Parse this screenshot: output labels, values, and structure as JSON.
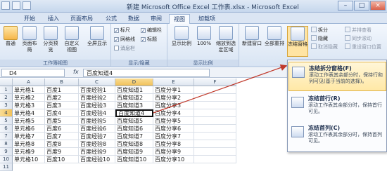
{
  "titlebar": {
    "title": "新建 Microsoft Office Excel 工作表.xlsx - Microsoft Excel",
    "minimize": "–",
    "maximize": "□",
    "close": "×"
  },
  "tabs": [
    "开始",
    "插入",
    "页面布局",
    "公式",
    "数据",
    "审阅",
    "视图",
    "加载项"
  ],
  "active_tab": "视图",
  "ribbon": {
    "workbook_views": {
      "label": "工作簿视图",
      "buttons": [
        "普通",
        "页面布局",
        "分页预览",
        "自定义视图",
        "全屏显示"
      ]
    },
    "show_hide": {
      "label": "显示/隐藏",
      "checks": [
        {
          "label": "标尺",
          "checked": true
        },
        {
          "label": "网格线",
          "checked": true
        },
        {
          "label": "消息栏",
          "checked": false
        },
        {
          "label": "编辑栏",
          "checked": true
        },
        {
          "label": "标题",
          "checked": true
        }
      ]
    },
    "zoom": {
      "label": "显示比例",
      "buttons": [
        "显示比例",
        "100%",
        "缩放到选定区域"
      ]
    },
    "window": {
      "buttons": [
        "新建窗口",
        "全部重排",
        "冻结窗格"
      ],
      "small": [
        "拆分",
        "隐藏",
        "取消隐藏",
        "并排查看",
        "同步滚动",
        "重设窗口位置"
      ]
    }
  },
  "formula_bar": {
    "name_box": "D4",
    "fx": "fx",
    "content": "百度知道4"
  },
  "columns": [
    "A",
    "B",
    "C",
    "D",
    "E",
    "F"
  ],
  "selected_column": "D",
  "selected_row": 4,
  "rows": [
    [
      "单元格1",
      "百度1",
      "百度经验1",
      "百度知道1",
      "百度分享1"
    ],
    [
      "单元格2",
      "百度2",
      "百度经验2",
      "百度知道2",
      "百度分享2"
    ],
    [
      "单元格3",
      "百度3",
      "百度经验3",
      "百度知道3",
      "百度分享3"
    ],
    [
      "单元格4",
      "百度4",
      "百度经验4",
      "百度知道4",
      "百度分享4"
    ],
    [
      "单元格5",
      "百度5",
      "百度经验5",
      "百度知道5",
      "百度分享5"
    ],
    [
      "单元格6",
      "百度6",
      "百度经验6",
      "百度知道6",
      "百度分享6"
    ],
    [
      "单元格7",
      "百度7",
      "百度经验7",
      "百度知道7",
      "百度分享7"
    ],
    [
      "单元格8",
      "百度8",
      "百度经验8",
      "百度知道8",
      "百度分享8"
    ],
    [
      "单元格9",
      "百度9",
      "百度经验9",
      "百度知道9",
      "百度分享9"
    ],
    [
      "单元格10",
      "百度10",
      "百度经验10",
      "百度知道10",
      "百度分享10"
    ]
  ],
  "freeze_menu": {
    "items": [
      {
        "title": "冻结拆分窗格(F)",
        "desc": "滚动工作表其余部分时，保持行和列可见(基于当前的选择)。",
        "highlighted": true
      },
      {
        "title": "冻结首行(R)",
        "desc": "滚动工作表其余部分时，保持首行可见。",
        "highlighted": false
      },
      {
        "title": "冻结首列(C)",
        "desc": "滚动工作表其余部分时，保持首列可见。",
        "highlighted": false
      }
    ]
  },
  "colors": {
    "selection_header": "#f1c15a",
    "menu_highlight": "#ffe8a6",
    "arrow": "#c0392b"
  }
}
